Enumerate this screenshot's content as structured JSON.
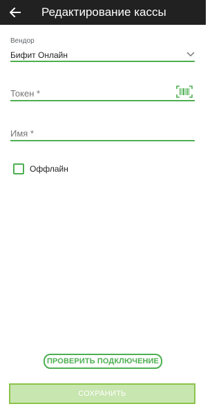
{
  "appbar": {
    "title": "Редактирование кассы",
    "back_icon": "arrow-left-icon"
  },
  "form": {
    "vendor": {
      "label": "Вендор",
      "value": "Бифит Онлайн",
      "dropdown_icon": "chevron-down-icon"
    },
    "token": {
      "placeholder": "Токен *",
      "value": "",
      "scan_icon": "barcode-scan-icon"
    },
    "name": {
      "placeholder": "Имя *",
      "value": ""
    },
    "offline": {
      "label": "Оффлайн",
      "checked": false
    }
  },
  "actions": {
    "test_connection_label": "ПРОВЕРИТЬ ПОДКЛЮЧЕНИЕ",
    "save_label": "СОХРАНИТЬ"
  },
  "colors": {
    "appbar": "#212121",
    "accent": "#4caf50",
    "save_bg": "#c8e6b0"
  }
}
